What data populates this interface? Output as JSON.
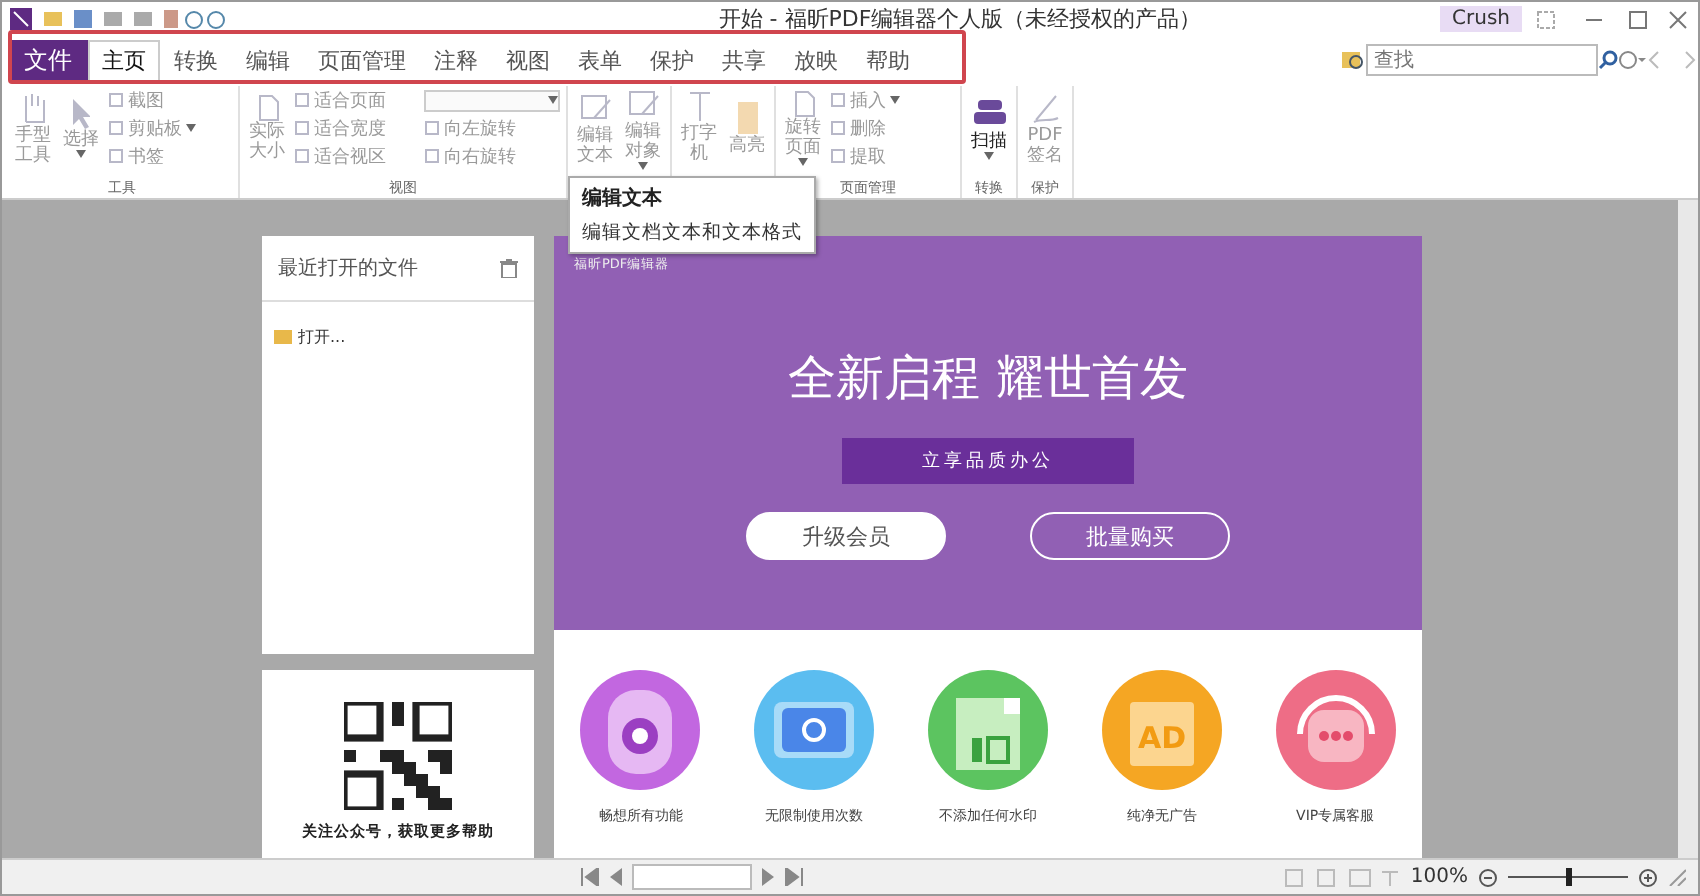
{
  "window": {
    "title": "开始 - 福昕PDF编辑器个人版（未经授权的产品）",
    "user": "Crush"
  },
  "menu": {
    "file": "文件",
    "tabs": [
      {
        "label": "主页",
        "selected": true
      },
      {
        "label": "转换",
        "selected": false
      },
      {
        "label": "编辑",
        "selected": false
      },
      {
        "label": "页面管理",
        "selected": false
      },
      {
        "label": "注释",
        "selected": false
      },
      {
        "label": "视图",
        "selected": false
      },
      {
        "label": "表单",
        "selected": false
      },
      {
        "label": "保护",
        "selected": false
      },
      {
        "label": "共享",
        "selected": false
      },
      {
        "label": "放映",
        "selected": false
      },
      {
        "label": "帮助",
        "selected": false
      }
    ]
  },
  "search": {
    "placeholder": "查找"
  },
  "ribbon": {
    "groups": [
      {
        "label": "工具",
        "items": [
          {
            "kind": "large",
            "label": "手型工具",
            "disabled": true
          },
          {
            "kind": "large",
            "label": "选择",
            "disabled": true,
            "dropdown": true
          },
          {
            "kind": "small",
            "label": "截图",
            "disabled": true
          },
          {
            "kind": "small",
            "label": "剪贴板",
            "disabled": true,
            "dropdown": true
          },
          {
            "kind": "small",
            "label": "书签",
            "disabled": true
          }
        ]
      },
      {
        "label": "视图",
        "items": [
          {
            "kind": "large",
            "label": "实际大小",
            "disabled": true
          },
          {
            "kind": "small",
            "label": "适合页面",
            "disabled": true
          },
          {
            "kind": "small",
            "label": "适合宽度",
            "disabled": true
          },
          {
            "kind": "small",
            "label": "适合视区",
            "disabled": true
          },
          {
            "kind": "field",
            "disabled": true,
            "dropdown": true
          },
          {
            "kind": "small",
            "label": "向左旋转",
            "disabled": true
          },
          {
            "kind": "small",
            "label": "向右旋转",
            "disabled": true
          }
        ]
      },
      {
        "items": [
          {
            "kind": "large",
            "label": "编辑文本",
            "disabled": true
          },
          {
            "kind": "large",
            "label": "编辑对象",
            "disabled": true,
            "dropdown": true
          }
        ]
      },
      {
        "items": [
          {
            "kind": "large",
            "label": "打字机",
            "disabled": true
          },
          {
            "kind": "large",
            "label": "高亮",
            "disabled": true
          }
        ]
      },
      {
        "label": "页面管理",
        "items": [
          {
            "kind": "large",
            "label": "旋转页面",
            "disabled": true,
            "dropdown": true
          },
          {
            "kind": "small",
            "label": "插入",
            "disabled": true,
            "dropdown": true
          },
          {
            "kind": "small",
            "label": "删除",
            "disabled": true
          },
          {
            "kind": "small",
            "label": "提取",
            "disabled": true
          }
        ]
      },
      {
        "label": "转换",
        "items": [
          {
            "kind": "large",
            "label": "扫描",
            "disabled": false,
            "dropdown": true
          }
        ]
      },
      {
        "label": "保护",
        "items": [
          {
            "kind": "large",
            "label": "PDF签名",
            "disabled": true
          }
        ]
      }
    ]
  },
  "tooltip": {
    "title": "编辑文本",
    "text": "编辑文档文本和文本格式"
  },
  "recent": {
    "title": "最近打开的文件",
    "items": [
      "打开..."
    ]
  },
  "qr": {
    "caption": "关注公众号，获取更多帮助"
  },
  "banner": {
    "brand": "福昕PDF编辑器",
    "headline": "全新启程 耀世首发",
    "ribbon": "立享品质办公",
    "buttons": [
      {
        "label": "升级会员",
        "kind": "filled"
      },
      {
        "label": "批量购买",
        "kind": "outline"
      }
    ]
  },
  "features": [
    {
      "label": "畅想所有功能",
      "kind": "gear",
      "color": "#c267e0"
    },
    {
      "label": "无限制使用次数",
      "kind": "refresh",
      "color": "#5bbdf0"
    },
    {
      "label": "不添加任何水印",
      "kind": "stamp",
      "color": "#5cc460"
    },
    {
      "label": "纯净无广告",
      "kind": "ad",
      "color": "#f5a623",
      "badge": "AD"
    },
    {
      "label": "VIP专属客服",
      "kind": "chat",
      "color": "#ee6d86"
    }
  ],
  "status": {
    "zoom": "100%",
    "zoom_slider": {
      "level": 0.5
    }
  }
}
